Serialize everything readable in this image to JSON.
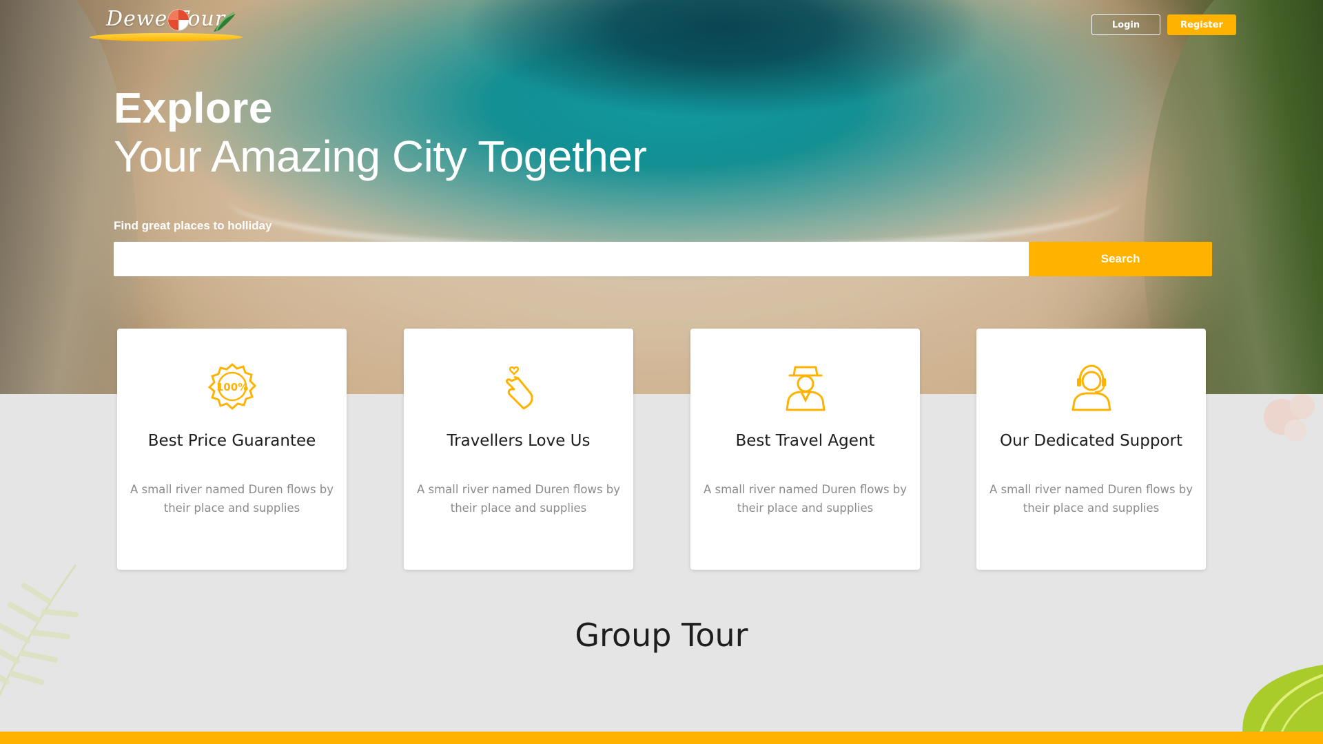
{
  "brand": {
    "logo_text": "Dewe Tour"
  },
  "nav": {
    "login_label": "Login",
    "register_label": "Register"
  },
  "hero": {
    "headline_bold": "Explore",
    "headline_light": "Your Amazing City Together",
    "search_label": "Find great places to holliday",
    "search_value": "",
    "search_button": "Search"
  },
  "features": [
    {
      "icon": "price-badge-100-icon",
      "title": "Best Price Guarantee",
      "description": "A small river named Duren flows by their place and supplies"
    },
    {
      "icon": "finger-heart-icon",
      "title": "Travellers Love Us",
      "description": "A small river named Duren flows by their place and supplies"
    },
    {
      "icon": "travel-agent-icon",
      "title": "Best Travel Agent",
      "description": "A small river named Duren flows by their place and supplies"
    },
    {
      "icon": "headset-support-icon",
      "title": "Our Dedicated Support",
      "description": "A small river named Duren flows by their place and supplies"
    }
  ],
  "section": {
    "title": "Group Tour"
  },
  "colors": {
    "accent": "#ffb300",
    "background": "#e5e5e5",
    "card": "#ffffff",
    "text_dark": "#1e1e1e",
    "text_muted": "#8a8a8a"
  }
}
